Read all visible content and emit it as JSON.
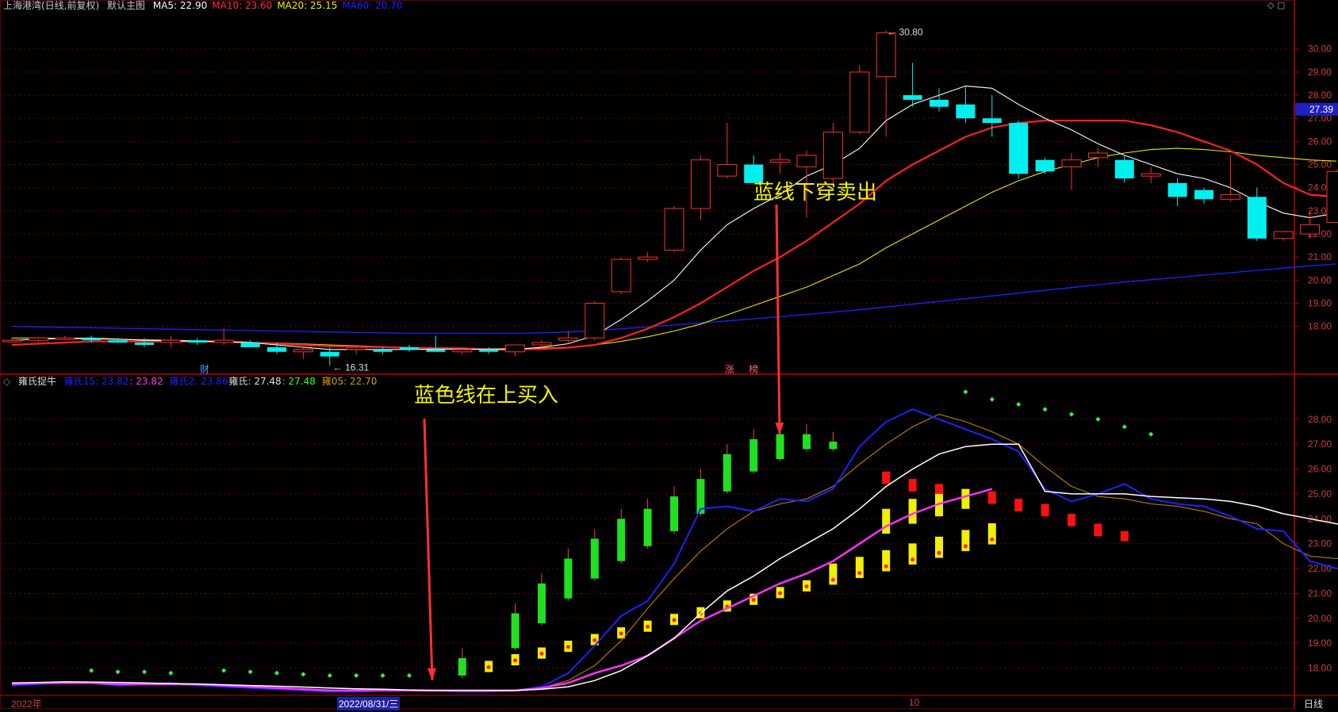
{
  "header": {
    "stock": "上海港湾(日线,前复权)",
    "view": "默认主图",
    "ma": [
      {
        "label": "MA5: 22.90",
        "color": "#ffffff"
      },
      {
        "label": "MA10: 23.60",
        "color": "#ff3030"
      },
      {
        "label": "MA20: 25.15",
        "color": "#f0f000"
      },
      {
        "label": "MA60: 20.70",
        "color": "#2020ff"
      }
    ]
  },
  "sub_header": {
    "name": "雍氏捉牛",
    "items": [
      {
        "label": "雍氏15: 23.82",
        "color": "#2020ff"
      },
      {
        "label": ": 23.82",
        "color": "#ff30ff"
      },
      {
        "label": "雍氏2: 23.86",
        "color": "#2020ff"
      },
      {
        "label": "雍氏: 27.48",
        "color": "#e0e0e0"
      },
      {
        "label": ": 27.48",
        "color": "#30ff30"
      },
      {
        "label": "雍05: 22.70",
        "color": "#d0a000"
      }
    ]
  },
  "annotations": {
    "sell": "蓝线下穿卖出",
    "buy": "蓝色线在上买入",
    "high_label": "30.80",
    "low_label": "16.31",
    "marker_cai": "财",
    "marker_zhang": "涨",
    "marker_bang": "榜",
    "price_tag": "27.39"
  },
  "footer": {
    "year": "2022年",
    "date": "2022/08/31/三",
    "month": "10",
    "period": "日线"
  },
  "colors": {
    "up": "#ff3030",
    "down": "#00f0f0",
    "ma5": "#ffffff",
    "ma10": "#ff2020",
    "ma20": "#e6e600",
    "ma60": "#2020ff",
    "grid": "#7a0000",
    "axis": "#c00000"
  },
  "chart_data": [
    {
      "type": "candlestick",
      "title": "上海港湾(日线,前复权)",
      "yticks": [
        18,
        19,
        20,
        21,
        22,
        23,
        24,
        25,
        26,
        27,
        28,
        29,
        30
      ],
      "ylim": [
        16.0,
        31.5
      ],
      "candles": [
        [
          17.4,
          17.5,
          17.3,
          17.4
        ],
        [
          17.4,
          17.5,
          17.3,
          17.5
        ],
        [
          17.5,
          17.6,
          17.4,
          17.5
        ],
        [
          17.5,
          17.6,
          17.3,
          17.4
        ],
        [
          17.4,
          17.5,
          17.3,
          17.3
        ],
        [
          17.3,
          17.5,
          17.1,
          17.2
        ],
        [
          17.3,
          17.6,
          17.1,
          17.4
        ],
        [
          17.4,
          17.5,
          17.2,
          17.3
        ],
        [
          17.3,
          17.9,
          17.2,
          17.4
        ],
        [
          17.3,
          17.4,
          17.1,
          17.1
        ],
        [
          17.1,
          17.3,
          16.8,
          16.9
        ],
        [
          16.9,
          17.1,
          16.6,
          17.0
        ],
        [
          16.9,
          17.1,
          16.3,
          16.7
        ],
        [
          17.0,
          17.2,
          16.8,
          17.1
        ],
        [
          17.0,
          17.1,
          16.8,
          16.9
        ],
        [
          17.1,
          17.2,
          16.9,
          17.0
        ],
        [
          17.0,
          17.6,
          16.9,
          16.9
        ],
        [
          16.9,
          17.1,
          16.8,
          17.0
        ],
        [
          17.0,
          17.1,
          16.8,
          16.9
        ],
        [
          16.9,
          17.1,
          16.7,
          17.2
        ],
        [
          17.2,
          17.4,
          17.0,
          17.3
        ],
        [
          17.4,
          17.8,
          17.3,
          17.5
        ],
        [
          17.5,
          19.1,
          17.4,
          19.0
        ],
        [
          19.5,
          21.0,
          19.4,
          20.9
        ],
        [
          20.9,
          21.2,
          20.8,
          21.0
        ],
        [
          21.3,
          23.2,
          21.2,
          23.1
        ],
        [
          23.1,
          25.4,
          22.6,
          25.2
        ],
        [
          24.5,
          26.8,
          24.4,
          25.0
        ],
        [
          25.0,
          25.4,
          24.4,
          24.2
        ],
        [
          25.1,
          25.5,
          24.6,
          25.2
        ],
        [
          24.9,
          25.6,
          22.7,
          25.4
        ],
        [
          24.4,
          26.8,
          24.2,
          26.4
        ],
        [
          26.4,
          29.3,
          26.3,
          29.0
        ],
        [
          28.8,
          30.8,
          26.2,
          30.7
        ],
        [
          28.0,
          29.4,
          27.5,
          27.8
        ],
        [
          27.8,
          28.3,
          27.3,
          27.5
        ],
        [
          27.6,
          28.4,
          26.8,
          27.0
        ],
        [
          27.0,
          28.0,
          26.2,
          26.8
        ],
        [
          26.8,
          26.9,
          24.4,
          24.6
        ],
        [
          25.2,
          25.3,
          24.6,
          24.7
        ],
        [
          24.9,
          25.5,
          23.9,
          25.2
        ],
        [
          25.3,
          25.7,
          24.9,
          25.5
        ],
        [
          25.2,
          25.4,
          24.2,
          24.4
        ],
        [
          24.5,
          24.9,
          24.2,
          24.6
        ],
        [
          24.2,
          24.4,
          23.2,
          23.6
        ],
        [
          23.9,
          24.0,
          23.3,
          23.5
        ],
        [
          23.5,
          25.4,
          23.4,
          23.7
        ],
        [
          23.6,
          24.0,
          21.7,
          21.8
        ],
        [
          21.8,
          22.1,
          21.7,
          22.1
        ],
        [
          22.0,
          23.0,
          21.8,
          22.4
        ],
        [
          22.5,
          24.8,
          22.5,
          24.7
        ]
      ],
      "ma5": [
        17.4,
        17.45,
        17.48,
        17.5,
        17.45,
        17.4,
        17.38,
        17.36,
        17.34,
        17.3,
        17.2,
        17.1,
        17.0,
        17.0,
        17.0,
        17.0,
        17.02,
        17.02,
        17.0,
        17.0,
        17.1,
        17.25,
        17.6,
        18.3,
        19.1,
        20.0,
        21.3,
        22.4,
        23.1,
        23.7,
        24.5,
        25.0,
        25.7,
        26.9,
        27.6,
        28.0,
        28.4,
        28.3,
        27.6,
        27.0,
        26.5,
        25.9,
        25.4,
        25.0,
        24.6,
        24.4,
        24.0,
        23.4,
        22.9,
        22.7,
        22.9
      ],
      "ma10": [
        17.2,
        17.25,
        17.3,
        17.35,
        17.35,
        17.35,
        17.35,
        17.35,
        17.33,
        17.3,
        17.25,
        17.2,
        17.15,
        17.12,
        17.1,
        17.08,
        17.06,
        17.05,
        17.02,
        17.0,
        17.02,
        17.08,
        17.2,
        17.5,
        17.9,
        18.4,
        19.0,
        19.7,
        20.4,
        21.0,
        21.7,
        22.5,
        23.3,
        24.3,
        25.0,
        25.6,
        26.2,
        26.6,
        26.8,
        26.9,
        26.9,
        26.9,
        26.9,
        26.7,
        26.4,
        26.0,
        25.6,
        25.0,
        24.2,
        23.7,
        23.6
      ],
      "ma20": [
        17.5,
        17.5,
        17.48,
        17.46,
        17.44,
        17.42,
        17.4,
        17.38,
        17.35,
        17.32,
        17.28,
        17.24,
        17.2,
        17.16,
        17.12,
        17.08,
        17.06,
        17.05,
        17.04,
        17.04,
        17.06,
        17.1,
        17.2,
        17.35,
        17.55,
        17.8,
        18.1,
        18.5,
        18.9,
        19.3,
        19.7,
        20.2,
        20.7,
        21.4,
        22.0,
        22.6,
        23.2,
        23.8,
        24.3,
        24.7,
        25.0,
        25.3,
        25.5,
        25.65,
        25.7,
        25.65,
        25.55,
        25.4,
        25.3,
        25.2,
        25.15
      ],
      "ma60": [
        18.0,
        17.98,
        17.96,
        17.94,
        17.92,
        17.9,
        17.88,
        17.86,
        17.84,
        17.82,
        17.8,
        17.78,
        17.76,
        17.74,
        17.72,
        17.7,
        17.7,
        17.7,
        17.7,
        17.7,
        17.72,
        17.76,
        17.82,
        17.9,
        17.98,
        18.06,
        18.15,
        18.24,
        18.33,
        18.42,
        18.52,
        18.62,
        18.72,
        18.84,
        18.96,
        19.08,
        19.2,
        19.32,
        19.44,
        19.56,
        19.68,
        19.8,
        19.92,
        20.02,
        20.12,
        20.22,
        20.32,
        20.42,
        20.52,
        20.62,
        20.7
      ]
    },
    {
      "type": "line",
      "title": "雍氏捉牛",
      "yticks": [
        18,
        19,
        20,
        21,
        22,
        23,
        24,
        25,
        26,
        27,
        28
      ],
      "ylim": [
        17.0,
        29.3
      ],
      "series": [
        {
          "name": "雍氏15",
          "color": "#2020ff",
          "values": [
            17.3,
            17.35,
            17.4,
            17.4,
            17.3,
            17.35,
            17.4,
            17.3,
            17.25,
            17.2,
            17.15,
            17.1,
            17.05,
            17.05,
            17.1,
            17.1,
            17.1,
            17.05,
            17.05,
            17.1,
            17.25,
            17.8,
            18.9,
            20.1,
            20.7,
            22.2,
            24.4,
            24.5,
            24.3,
            24.8,
            24.7,
            25.2,
            26.9,
            27.9,
            28.4,
            28.0,
            27.6,
            27.2,
            26.7,
            25.2,
            24.7,
            25.0,
            25.4,
            24.8,
            24.6,
            24.5,
            24.1,
            23.6,
            23.5,
            22.3,
            22.0,
            22.3,
            23.7
          ]
        },
        {
          "name": "雍氏",
          "color": "#c08000",
          "values": [
            17.3,
            17.35,
            17.4,
            17.4,
            17.35,
            17.35,
            17.35,
            17.3,
            17.3,
            17.25,
            17.2,
            17.15,
            17.1,
            17.1,
            17.1,
            17.1,
            17.1,
            17.1,
            17.1,
            17.1,
            17.2,
            17.5,
            18.1,
            19.1,
            20.4,
            21.6,
            22.7,
            23.6,
            24.3,
            24.6,
            24.8,
            25.3,
            26.2,
            27.0,
            27.7,
            28.2,
            27.9,
            27.5,
            27.0,
            26.1,
            25.3,
            24.9,
            24.8,
            24.6,
            24.5,
            24.3,
            24.0,
            23.8,
            23.0,
            22.5,
            22.4,
            22.6,
            22.7
          ]
        },
        {
          "name": "雍氏2",
          "color": "#ff30ff",
          "values": [
            17.35,
            17.4,
            17.4,
            17.4,
            17.35,
            17.35,
            17.35,
            17.35,
            17.3,
            17.25,
            17.2,
            17.15,
            17.1,
            17.1,
            17.1,
            17.1,
            17.1,
            17.1,
            17.1,
            17.1,
            17.2,
            17.4,
            17.8,
            18.1,
            18.5,
            19.2,
            19.9,
            20.4,
            20.9,
            21.4,
            21.8,
            22.3,
            23.0,
            23.7,
            24.2,
            24.6,
            24.9,
            25.2
          ]
        },
        {
          "name": "白线",
          "color": "#ffffff",
          "values": [
            17.4,
            17.42,
            17.45,
            17.44,
            17.42,
            17.4,
            17.38,
            17.36,
            17.33,
            17.3,
            17.27,
            17.24,
            17.2,
            17.17,
            17.15,
            17.12,
            17.1,
            17.1,
            17.1,
            17.1,
            17.15,
            17.25,
            17.5,
            17.9,
            18.5,
            19.2,
            20.2,
            21.1,
            21.7,
            22.4,
            23.0,
            23.6,
            24.4,
            25.3,
            26.0,
            26.6,
            26.9,
            27.0,
            27.0,
            25.1,
            25.0,
            25.0,
            25.0,
            24.9,
            24.85,
            24.8,
            24.7,
            24.5,
            24.2,
            24.0,
            23.8,
            23.7,
            23.8
          ]
        }
      ]
    }
  ]
}
